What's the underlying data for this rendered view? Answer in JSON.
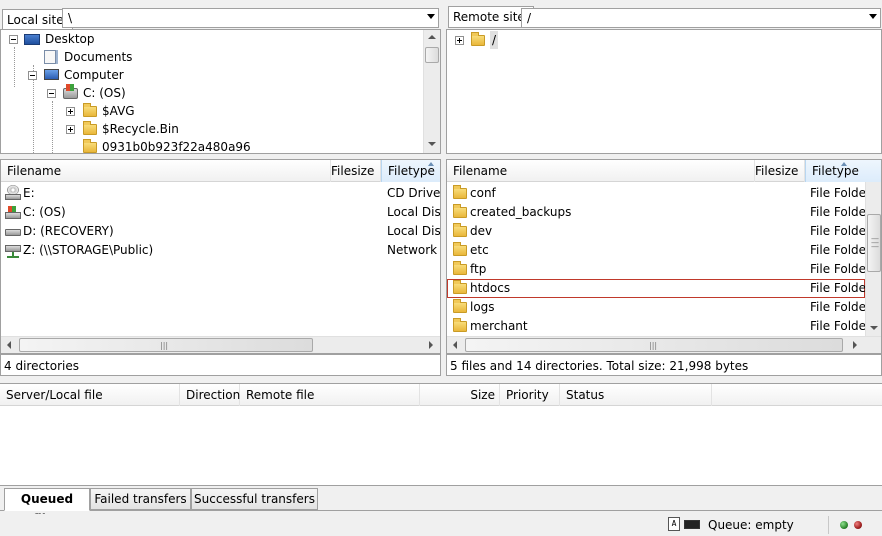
{
  "local": {
    "site_label": "Local site:",
    "site_path": "\\",
    "tree": [
      {
        "label": "Desktop",
        "icon": "desktop-icon"
      },
      {
        "label": "Documents",
        "icon": "documents-icon"
      },
      {
        "label": "Computer",
        "icon": "computer-icon"
      },
      {
        "label": "C: (OS)",
        "icon": "drive-icon"
      },
      {
        "label": "$AVG",
        "icon": "folder-icon"
      },
      {
        "label": "$Recycle.Bin",
        "icon": "folder-icon"
      },
      {
        "label": "0931b0b923f22a480a96",
        "icon": "folder-icon"
      }
    ],
    "columns": {
      "filename": "Filename",
      "filesize": "Filesize",
      "filetype": "Filetype"
    },
    "files": [
      {
        "name": "E:",
        "type": "CD Drive",
        "icon": "cd-drive-icon"
      },
      {
        "name": "C: (OS)",
        "type": "Local Disk",
        "icon": "os-drive-icon"
      },
      {
        "name": "D: (RECOVERY)",
        "type": "Local Disk",
        "icon": "drive-icon"
      },
      {
        "name": "Z: (\\\\STORAGE\\Public)",
        "type": "Network D",
        "icon": "network-drive-icon"
      }
    ],
    "status": "4 directories"
  },
  "remote": {
    "site_label": "Remote site:",
    "site_path": "/",
    "tree": [
      {
        "label": "/",
        "icon": "folder-icon"
      }
    ],
    "columns": {
      "filename": "Filename",
      "filesize": "Filesize",
      "filetype": "Filetype"
    },
    "files": [
      {
        "name": "conf",
        "type": "File Folder"
      },
      {
        "name": "created_backups",
        "type": "File Folder"
      },
      {
        "name": "dev",
        "type": "File Folder"
      },
      {
        "name": "etc",
        "type": "File Folder"
      },
      {
        "name": "ftp",
        "type": "File Folder"
      },
      {
        "name": "htdocs",
        "type": "File Folder",
        "selected": true
      },
      {
        "name": "logs",
        "type": "File Folder"
      },
      {
        "name": "merchant",
        "type": "File Folder"
      }
    ],
    "status": "5 files and 14 directories. Total size: 21,998 bytes"
  },
  "queue": {
    "columns": {
      "server_local_file": "Server/Local file",
      "direction": "Direction",
      "remote_file": "Remote file",
      "size": "Size",
      "priority": "Priority",
      "status": "Status"
    },
    "tabs": [
      "Queued files",
      "Failed transfers",
      "Successful transfers"
    ],
    "active_tab": "Queued files"
  },
  "statusbar": {
    "queue_text": "Queue: empty",
    "colors": {
      "led_left": "#2f8a2f",
      "led_right": "#a02020"
    }
  },
  "colors": {
    "selection_border": "#c0392b",
    "folder": "#f1c959"
  }
}
